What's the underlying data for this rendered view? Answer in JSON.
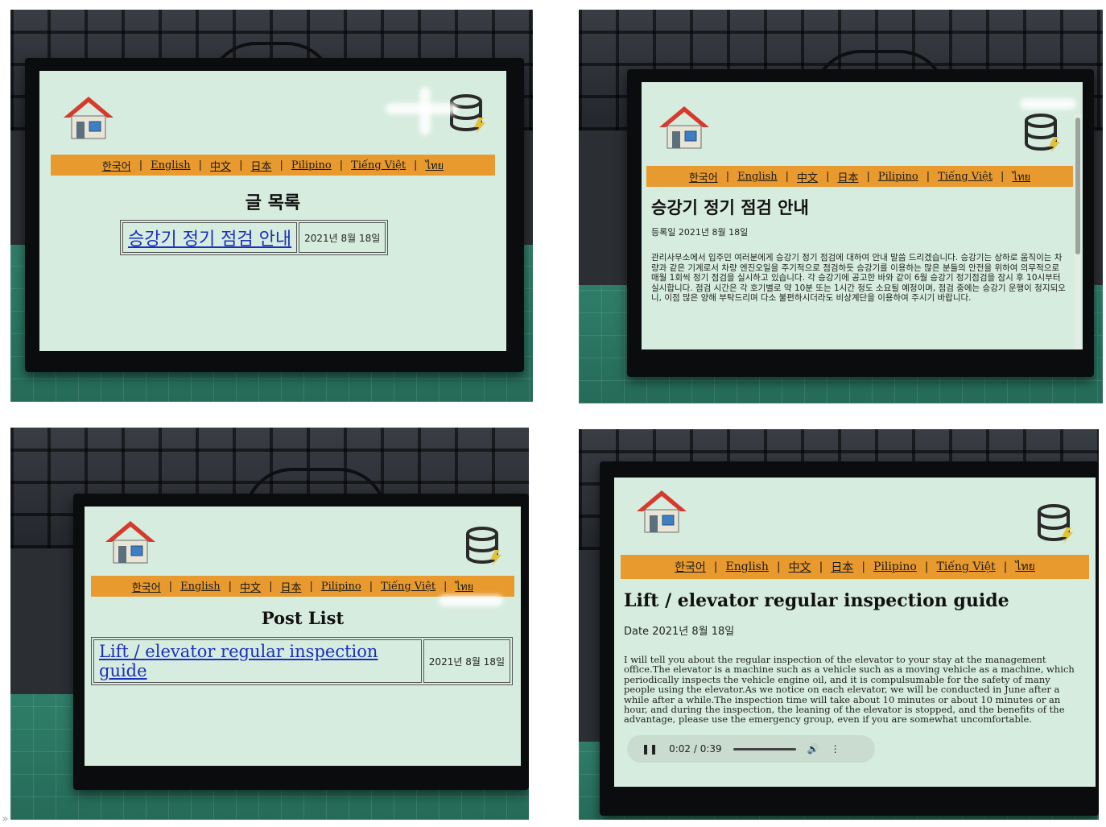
{
  "icons": {
    "home": "house-icon",
    "server": "database-bolt-icon"
  },
  "nav": {
    "korean": "한국어",
    "english": "English",
    "chinese": "中文",
    "japanese": "日本",
    "filipino": "Pilipino",
    "vietnamese": "Tiếng Việt",
    "thai": "ไทย",
    "separator": "|"
  },
  "colors": {
    "nav_bar": "#e89a2e",
    "screen_bg": "#d6ecde",
    "link": "#1a2fbf"
  },
  "panels": [
    {
      "heading": "글 목록",
      "post_title": "승강기 정기 점검 안내",
      "post_date": "2021년 8월 18일"
    },
    {
      "title": "승강기 정기 점검 안내",
      "date": "등록일 2021년 8월 18일",
      "body": "관리사무소에서 입주민 여러분에게 승강기 정기 점검에 대하여 안내 말씀 드리겠습니다. 승강기는 상하로 움직이는 차량과 같은 기계로서 차량 엔진오일을 주기적으로 점검하듯 승강기를 이용하는 많은 분들의 안전을 위하여 의무적으로 매월 1회씩 정기 점검을 실시하고 있습니다. 각 승강기에 공고한 바와 같이 6월 승강기 정기점검을 잠시 후 10시부터 실시합니다. 점검 시간은 각 호기별로 약 10분 또는 1시간 정도 소요될 예정이며, 점검 중에는 승강기 운행이 정지되오니, 이점 많은 양해 부탁드리며 다소 불편하시더라도 비상계단을 이용하여 주시기 바랍니다."
    },
    {
      "heading": "Post List",
      "post_title": "Lift / elevator regular inspection guide",
      "post_date": "2021년 8월 18일"
    },
    {
      "title": "Lift / elevator regular inspection guide",
      "date": "Date 2021년 8월 18일",
      "body": "I will tell you about the regular inspection of the elevator to your stay at the management office.The elevator is a machine such as a vehicle such as a moving vehicle as a machine, which periodically inspects the vehicle engine oil, and it is compulsumable for the safety of many people using the elevator.As we notice on each elevator, we will be conducted in June after a while after a while.The inspection time will take about 10 minutes or about 10 minutes or an hour, and during the inspection, the leaning of the elevator is stopped, and the benefits of the advantage, please use the emergency group, even if you are somewhat uncomfortable.",
      "audio_time": "0:02 / 0:39"
    }
  ],
  "corner_glyph": "»"
}
